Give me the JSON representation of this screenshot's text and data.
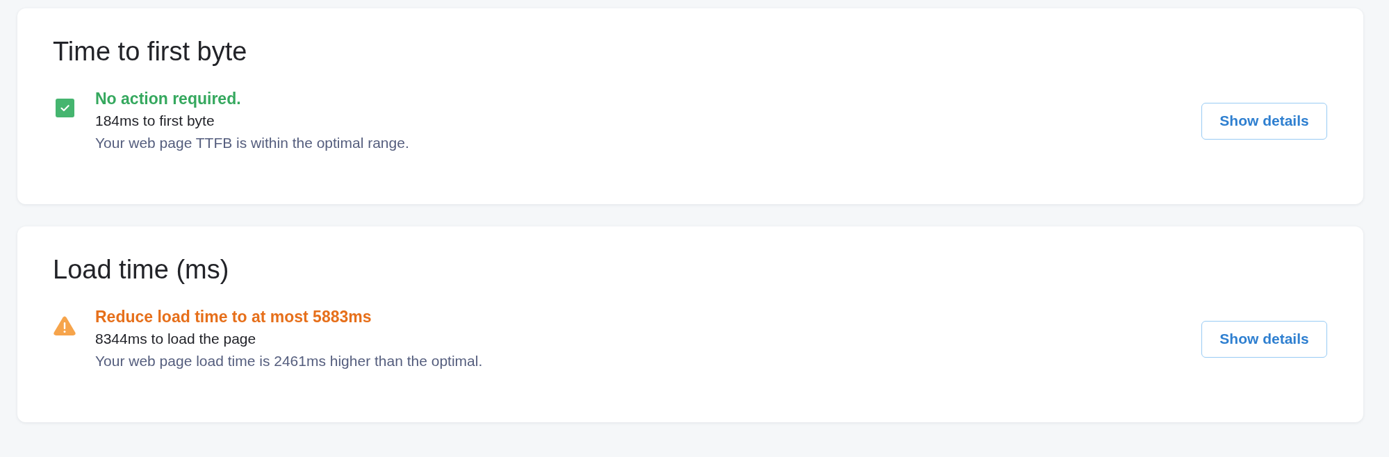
{
  "sections": [
    {
      "title": "Time to first byte",
      "status": {
        "kind": "success",
        "headline": "No action required.",
        "metric": "184ms to first byte",
        "description": "Your web page TTFB is within the optimal range."
      },
      "button": "Show details"
    },
    {
      "title": "Load time (ms)",
      "status": {
        "kind": "warning",
        "headline": "Reduce load time to at most 5883ms",
        "metric": "8344ms to load the page",
        "description": "Your web page load time is 2461ms higher than the optimal."
      },
      "button": "Show details"
    }
  ]
}
